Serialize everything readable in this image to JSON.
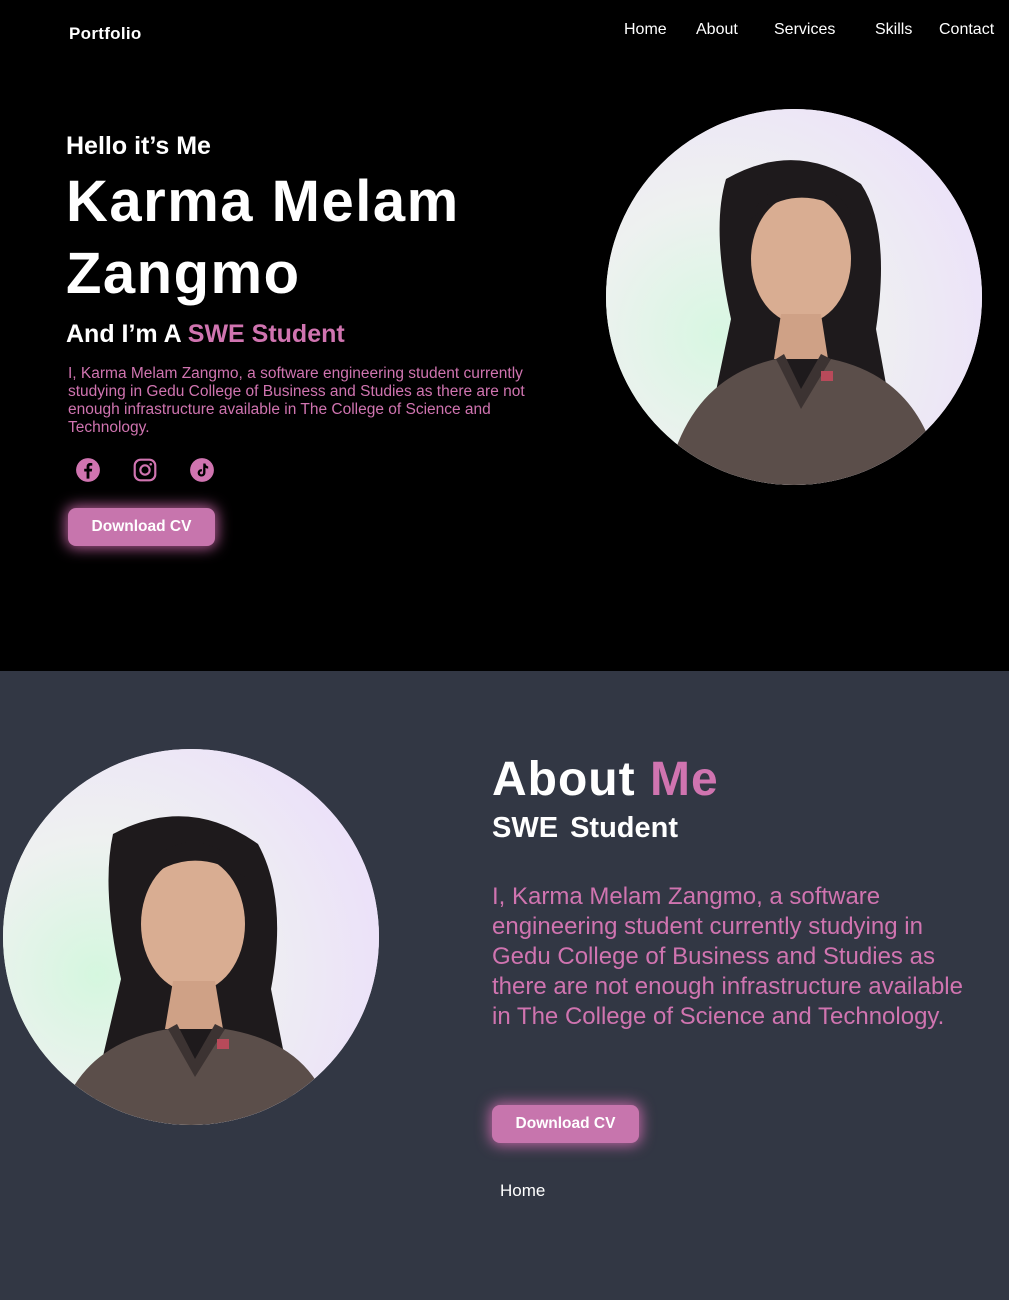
{
  "nav": {
    "logo": "Portfolio",
    "links": [
      "Home",
      "About",
      "Services",
      "Skills",
      "Contact"
    ]
  },
  "hero": {
    "greeting": "Hello it’s Me",
    "name": "Karma Melam Zangmo",
    "role_prefix": "And I’m A",
    "role_accent": "SWE Student",
    "description": "I, Karma Melam Zangmo, a software engineering student currently studying in Gedu College of Business and Studies as there are not enough infrastructure available in The College of Science and Technology.",
    "socials": [
      "facebook-icon",
      "instagram-icon",
      "tiktok-icon"
    ],
    "cta": "Download CV"
  },
  "about": {
    "title_main": "About",
    "title_accent": "Me",
    "subtitle_1": "SWE",
    "subtitle_2": "Student",
    "description": "I, Karma Melam Zangmo, a software engineering student currently studying in Gedu College of Business and Studies as there are not enough infrastructure available in The College of Science and Technology.",
    "cta": "Download CV",
    "footer_link": "Home"
  },
  "colors": {
    "accent": "#d074b0",
    "hero_bg": "#000000",
    "about_bg": "#323744",
    "button": "#c775ad"
  }
}
